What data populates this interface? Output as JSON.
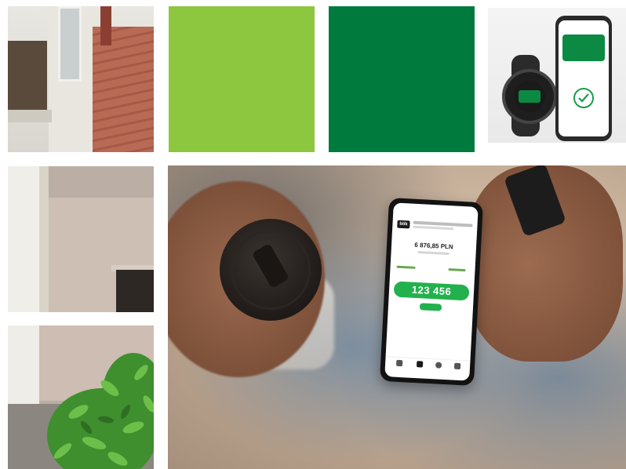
{
  "collage": {
    "tiles": [
      {
        "id": "facade",
        "subject": "building facade with red tiled roof"
      },
      {
        "id": "light-green",
        "color": "#8dc63f"
      },
      {
        "id": "dark-green",
        "color": "#007a3d"
      },
      {
        "id": "devices",
        "subject": "smartwatch and smartphone with green card and check mark"
      },
      {
        "id": "wall",
        "subject": "building wall with doorway"
      },
      {
        "id": "plant",
        "subject": "green shrub in front of building"
      },
      {
        "id": "hands",
        "subject": "person holding coffee cup and smartphone"
      }
    ]
  },
  "phone": {
    "logo": "blik",
    "amount": "6 876,85 PLN",
    "code": "123 456"
  },
  "icons": [
    "check-icon"
  ],
  "colors": {
    "accent_light": "#8dc63f",
    "accent_dark": "#007a3d",
    "code_green": "#22b14c"
  }
}
